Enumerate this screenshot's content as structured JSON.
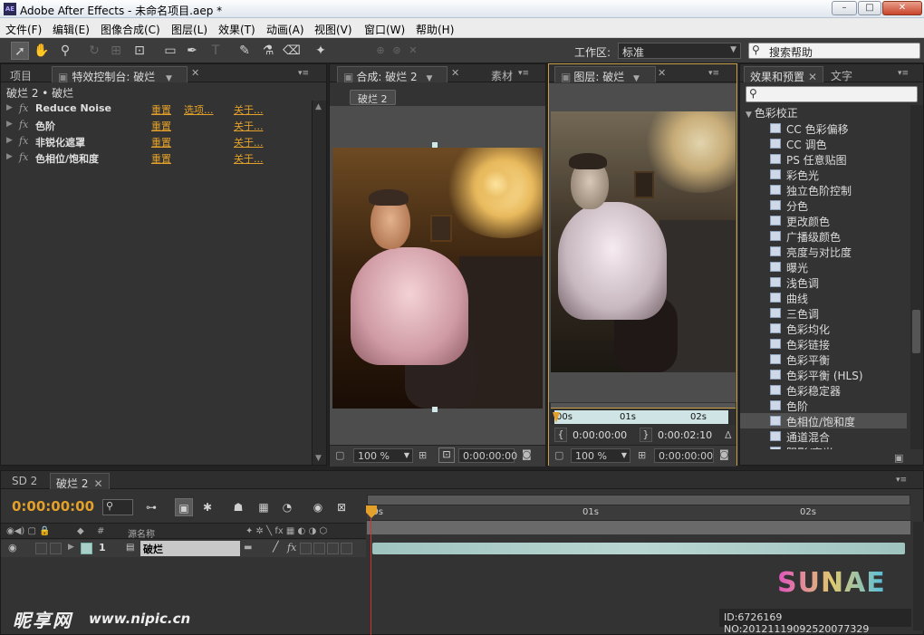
{
  "window": {
    "title": "Adobe After Effects - 未命名项目.aep *",
    "app_icon": "AE"
  },
  "window_controls": {
    "minimize": "–",
    "maximize": "□",
    "close": "✕"
  },
  "menu": [
    "文件(F)",
    "编辑(E)",
    "图像合成(C)",
    "图层(L)",
    "效果(T)",
    "动画(A)",
    "视图(V)",
    "窗口(W)",
    "帮助(H)"
  ],
  "toolbar": {
    "workspace_label": "工作区:",
    "workspace_value": "标准",
    "search_placeholder": "搜索帮助"
  },
  "left_panel": {
    "tabs": [
      "项目",
      "特效控制台: 破烂"
    ],
    "layer_path": "破烂 2 • 破烂",
    "effects": [
      {
        "name": "Reduce Noise",
        "reset": "重置",
        "option": "选项...",
        "about": "关于..."
      },
      {
        "name": "色阶",
        "reset": "重置",
        "option": "",
        "about": "关于..."
      },
      {
        "name": "非锐化遮罩",
        "reset": "重置",
        "option": "",
        "about": "关于..."
      },
      {
        "name": "色相位/饱和度",
        "reset": "重置",
        "option": "",
        "about": "关于..."
      }
    ]
  },
  "comp_panel": {
    "tab": "合成: 破烂 2",
    "tab2": "素材",
    "comp_button": "破烂 2",
    "zoom": "100 %",
    "timecode": "0:00:00:00"
  },
  "layer_panel": {
    "tab": "图层: 破烂",
    "ruler": [
      "00s",
      "01s",
      "02s"
    ],
    "in_time": "0:00:00:00",
    "out_time": "0:00:02:10",
    "delta": "Δ",
    "zoom": "100 %",
    "timecode": "0:00:00:00"
  },
  "effects_panel": {
    "tabs": [
      "效果和预置",
      "文字"
    ],
    "category": "色彩校正",
    "items": [
      "CC 色彩偏移",
      "CC 调色",
      "PS 任意贴图",
      "彩色光",
      "独立色阶控制",
      "分色",
      "更改颜色",
      "广播级颜色",
      "亮度与对比度",
      "曝光",
      "浅色调",
      "曲线",
      "三色调",
      "色彩均化",
      "色彩链接",
      "色彩平衡",
      "色彩平衡 (HLS)",
      "色彩稳定器",
      "色阶",
      "色相位/饱和度",
      "通道混合",
      "阴影/高光"
    ],
    "selected_index": 19
  },
  "timeline": {
    "tabs": [
      "SD 2",
      "破烂 2"
    ],
    "timecode": "0:00:00:00",
    "col_hash": "#",
    "col_source": "源名称",
    "layer": {
      "index": "1",
      "name": "破烂"
    },
    "ruler": [
      "00s",
      "01s",
      "02s"
    ]
  },
  "watermark": {
    "site_cn": "昵享网",
    "site_url": "www.nipic.cn",
    "logo": "SUNAE",
    "id_text": "ID:6726169 NO:20121119092520077329"
  },
  "colors": {
    "accent_orange": "#e3a02a",
    "timecode": "#e3a02a",
    "playhead": "#d83030",
    "layer_bar": "#9fc4c0"
  }
}
